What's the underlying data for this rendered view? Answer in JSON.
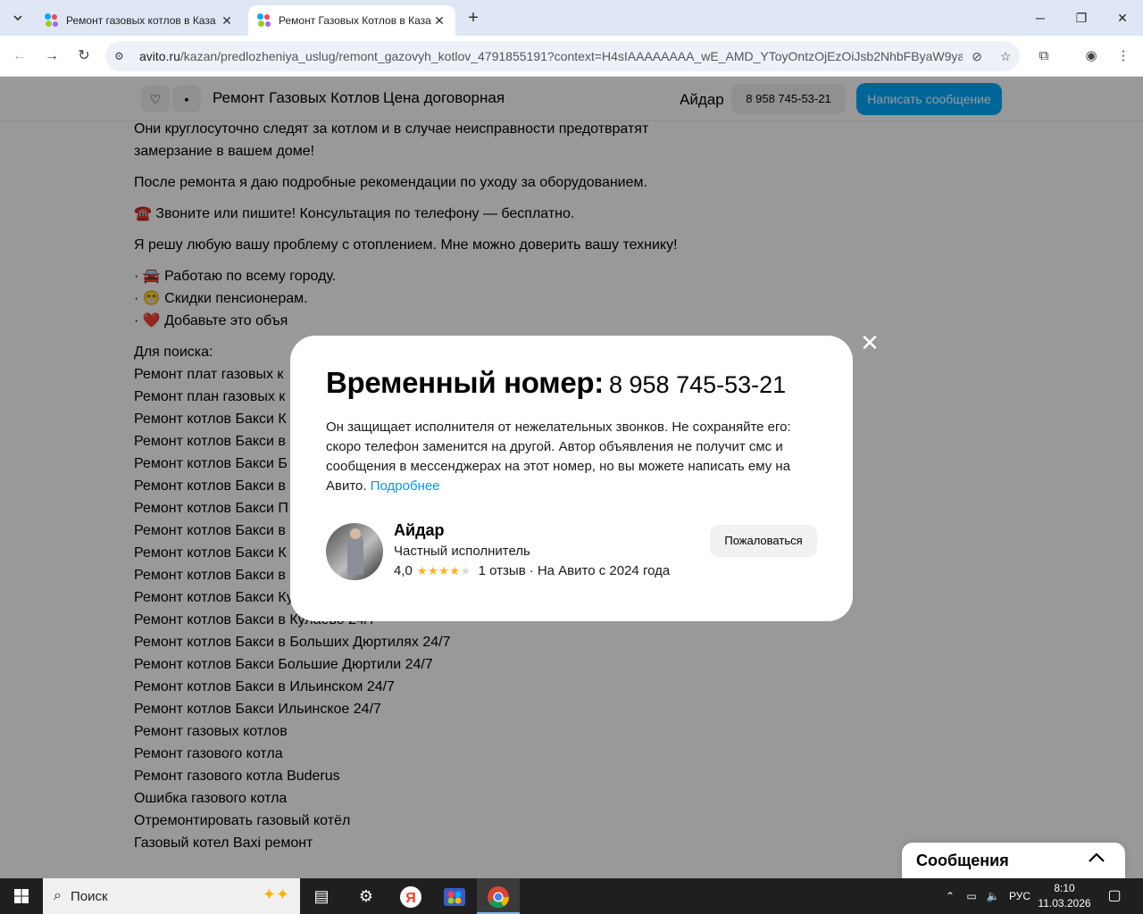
{
  "browser": {
    "tabs": [
      {
        "title": "Ремонт газовых котлов в Каза",
        "active": false
      },
      {
        "title": "Ремонт Газовых Котлов в Каза",
        "active": true
      }
    ],
    "new_tab": "+",
    "url_host": "avito.ru",
    "url_path": "/kazan/predlozheniya_uslug/remont_gazovyh_kotlov_4791855191?context=H4sIAAAAAAAA_wE_AMD_YToyOntzOjEzOiJsb2NhbFByaW9ya..."
  },
  "sticky_header": {
    "title": "Ремонт Газовых Котлов",
    "price": "Цена договорная",
    "seller": "Айдар",
    "phone": "8 958 745-53-21",
    "message_button": "Написать сообщение"
  },
  "description": {
    "paragraphs": [
      "Они круглосуточно следят за котлом и в случае неисправности предотвратят замерзание в вашем доме!",
      "После ремонта я даю подробные рекомендации по уходу за оборудованием.",
      "☎️ Звоните или пишите! Консультация по телефону — бесплатно.",
      "Я решу любую вашу проблему с отоплением. Мне можно доверить вашу технику!"
    ],
    "bullets": [
      "· 🚘 Работаю по всему городу.",
      "· 😁 Скидки пенсионерам.",
      "· ❤️ Добавьте это объя"
    ],
    "search_label": "Для поиска:",
    "search_lines": [
      "Ремонт плат газовых к",
      "Ремонт план газовых к",
      "Ремонт котлов Бакси К",
      "Ремонт котлов Бакси в",
      "Ремонт котлов Бакси Б",
      "Ремонт котлов Бакси в",
      "Ремонт котлов Бакси П",
      "Ремонт котлов Бакси в",
      "Ремонт котлов Бакси К",
      "Ремонт котлов Бакси в",
      "Ремонт котлов Бакси Кулаево 24/7",
      "Ремонт котлов Бакси в Кулаево 24/7",
      "Ремонт котлов Бакси в Больших Дюртилях 24/7",
      "Ремонт котлов Бакси Большие Дюртили 24/7",
      "Ремонт котлов Бакси в Ильинском 24/7",
      "Ремонт котлов Бакси Ильинское 24/7",
      "Ремонт газовых котлов",
      "Ремонт газового котла",
      "Ремонт газового котла Buderus",
      "Ошибка газового котла",
      "Отремонтировать газовый котёл",
      "Газовый котел Baxi ремонт"
    ]
  },
  "modal": {
    "title": "Временный номер:",
    "phone": "8 958 745-53-21",
    "text": "Он защищает исполнителя от нежелательных звонков. Не сохраняйте его: скоро телефон заменится на другой. Автор объявления не получит смс и сообщения в мессенджерах на этот номер, но вы можете написать ему на Авито.",
    "link": "Подробнее",
    "seller_name": "Айдар",
    "seller_role": "Частный исполнитель",
    "rating": "4,0",
    "rating_value": 4,
    "reviews": "1 отзыв",
    "since": "· На Авито с 2024 года",
    "report_button": "Пожаловаться",
    "close": "✕"
  },
  "messages_widget": {
    "label": "Сообщения"
  },
  "taskbar": {
    "search_placeholder": "Поиск",
    "lang": "РУС",
    "time": "8:10",
    "date": "11.03.2026"
  },
  "colors": {
    "accent": "#00aaff",
    "link": "#0099f7",
    "star": "#ffb021"
  }
}
